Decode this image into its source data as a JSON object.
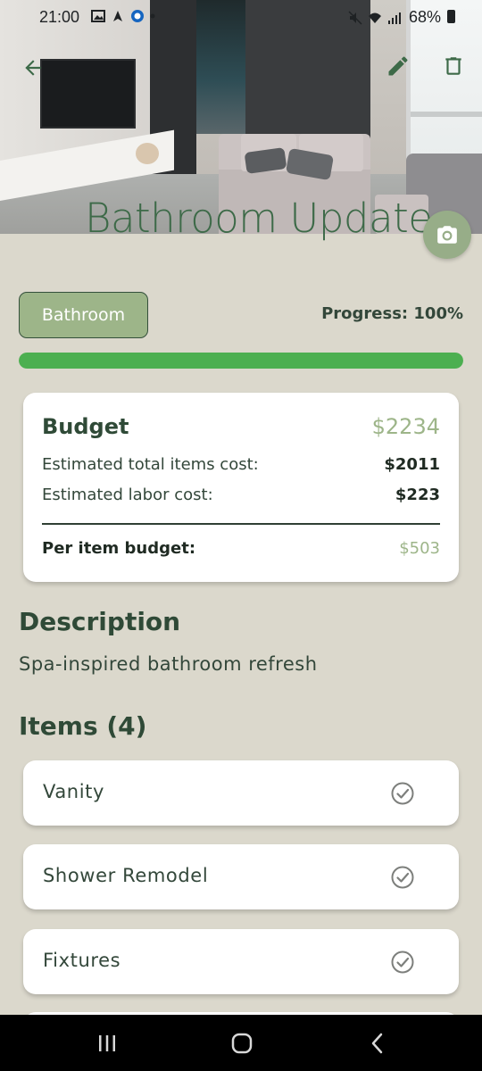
{
  "status_bar": {
    "time": "21:00",
    "battery": "68%"
  },
  "header": {
    "title": "Bathroom Update",
    "back_icon": "arrow-back-icon",
    "edit_icon": "pencil-icon",
    "delete_icon": "trash-icon",
    "camera_icon": "camera-icon"
  },
  "category": {
    "label": "Bathroom"
  },
  "progress": {
    "label": "Progress: 100%",
    "value_percent": 100,
    "color": "#4caf50"
  },
  "budget": {
    "title": "Budget",
    "total": "$2234",
    "rows": [
      {
        "label": "Estimated total items cost:",
        "value": "$2011"
      },
      {
        "label": "Estimated labor cost:",
        "value": "$223"
      }
    ],
    "per_item": {
      "label": "Per item budget:",
      "value": "$503"
    }
  },
  "description": {
    "heading": "Description",
    "text": "Spa-inspired bathroom refresh"
  },
  "items": {
    "heading": "Items (4)",
    "list": [
      {
        "label": "Vanity",
        "icon": "check-circle-icon"
      },
      {
        "label": "Shower Remodel",
        "icon": "check-circle-icon"
      },
      {
        "label": "Fixtures",
        "icon": "check-circle-icon"
      }
    ]
  },
  "colors": {
    "background": "#dbd8cc",
    "accent_green": "#9db589",
    "dark_green": "#2f4a37",
    "title_green": "#3d6a48"
  },
  "nav": {
    "recent_icon": "recent-apps-icon",
    "home_icon": "home-icon",
    "back_icon": "nav-back-icon"
  }
}
